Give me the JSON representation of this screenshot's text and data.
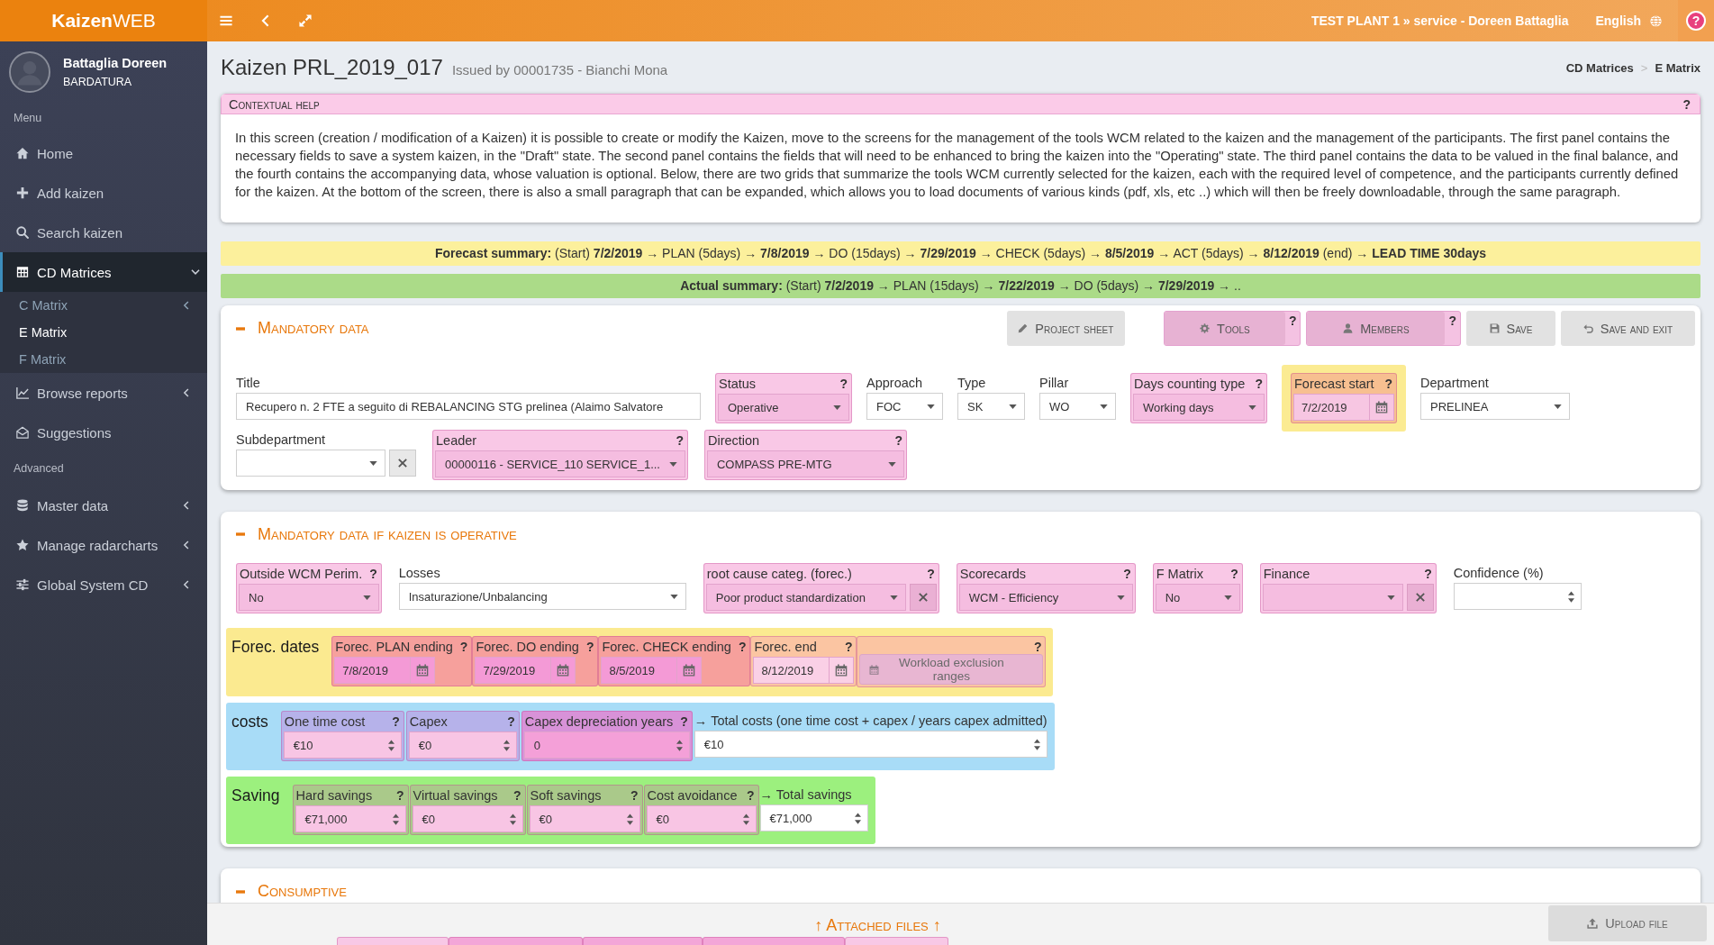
{
  "topbar": {
    "logo": "**Kaizen**WEB",
    "context": "TEST PLANT 1 » service - Doreen Battaglia",
    "language": "English",
    "help": "?"
  },
  "user": {
    "name": "Battaglia Doreen",
    "role": "BARDATURA"
  },
  "sidebar": {
    "sections": [
      {
        "heading": "Menu",
        "items": [
          {
            "label": "Home",
            "kind": "link",
            "selected": false
          },
          {
            "label": "Add kaizen",
            "kind": "link",
            "selected": false
          },
          {
            "label": "Search kaizen",
            "kind": "link",
            "selected": false
          },
          {
            "label": "CD Matrices",
            "kind": "group",
            "selected": true,
            "expanded": true,
            "children": [
              {
                "label": "C Matrix",
                "kind": "group",
                "selected": false,
                "expanded": false
              },
              {
                "label": "E Matrix",
                "kind": "link",
                "selected": true
              },
              {
                "label": "F Matrix",
                "kind": "link",
                "selected": false
              }
            ]
          },
          {
            "label": "Browse reports",
            "kind": "group",
            "selected": false,
            "expanded": false
          },
          {
            "label": "Suggestions",
            "kind": "link",
            "selected": false
          }
        ]
      },
      {
        "heading": "Advanced",
        "items": [
          {
            "label": "Master data",
            "kind": "group",
            "selected": false,
            "expanded": false
          },
          {
            "label": "Manage radarcharts",
            "kind": "group",
            "selected": false,
            "expanded": false
          },
          {
            "label": "Global System CD",
            "kind": "group",
            "selected": false,
            "expanded": false
          }
        ]
      }
    ]
  },
  "page": {
    "title": "Kaizen PRL_2019_017",
    "subtitle": "Issued by 00001735 - Bianchi Mona",
    "breadcrumb": [
      "CD Matrices",
      "E Matrix"
    ],
    "separator": ">"
  },
  "help_panel": {
    "title": "Contextual help",
    "help": "?",
    "text": "In this screen (creation / modification of a Kaizen) it is possible to create or modify the Kaizen, move to the screens for the management of the tools WCM related to the kaizen and the management of the participants. The first panel contains the necessary fields to save a system kaizen, in the \"Draft\" state. The second panel contains the fields that will need to be enhanced to bring the kaizen into the \"Operating\" state. The third panel contains the data to be valued in the final balance, and the fourth contains the accompanying data, whose valuation is optional. Below, there are two grids that summarize the tools WCM currently selected for the kaizen, each with the required level of competence, and the participants currently defined for the kaizen. At the bottom of the screen, there is also a small paragraph that can be expanded, which allows you to load documents of various kinds (pdf, xls, etc ..) which will then be freely downloadable, through the same paragraph."
  },
  "forecast_summary": "**Forecast summary:** (Start) **7/2/2019** → PLAN (5days) → **7/8/2019** → DO (15days) → **7/29/2019** → CHECK (5days) → **8/5/2019** → ACT (5days) → **8/12/2019** (end) → **LEAD TIME 30days**",
  "actual_summary": "**Actual summary:** (Start) **7/2/2019** → PLAN (15days) → **7/22/2019** → DO (5days) → **7/29/2019** → ..",
  "mandatory_panel": {
    "title": "Mandatory data",
    "buttons": [
      {
        "label": "Project sheet"
      },
      {
        "label": "Tools",
        "help": "?",
        "color": "#f4c2e2"
      },
      {
        "label": "Members",
        "help": "?",
        "color": "#f4c2e2"
      },
      {
        "label": "Save"
      },
      {
        "label": "Save and exit"
      }
    ],
    "rows": [
      {
        "fields": [
          {
            "label": "Title",
            "kind": "text",
            "value": "Recupero n. 2 FTE a seguito di REBALANCING STG prelinea (Alaimo Salvatore"
          },
          {
            "label": "Status",
            "kind": "select",
            "value": "Operative",
            "help": "?",
            "color": "#f9c8e6",
            "input": {
              "color": "#f5bde0"
            }
          },
          {
            "label": "Approach",
            "kind": "select",
            "value": "FOC"
          },
          {
            "label": "Type",
            "kind": "select",
            "value": "SK"
          },
          {
            "label": "Pillar",
            "kind": "select",
            "value": "WO"
          },
          {
            "label": "Days counting type",
            "kind": "select",
            "value": "Working days",
            "help": "?",
            "color": "#f9c8e6",
            "input": {
              "color": "#f5bde0"
            }
          },
          {
            "label": "Forecast start",
            "kind": "date",
            "value": "7/2/2019",
            "help": "?",
            "color": "#f7bf90",
            "input": {
              "color": "#f7c6e2"
            },
            "backing": {
              "color": "#fbeb92"
            }
          },
          {
            "label": "Department",
            "kind": "select",
            "value": "PRELINEA"
          }
        ]
      },
      {
        "fields": [
          {
            "label": "Subdepartment",
            "kind": "select-clear"
          },
          {
            "label": "Leader",
            "kind": "select",
            "value": "00000116 - SERVICE_110 SERVICE_1...",
            "help": "?",
            "color": "#f9c8e6",
            "input": {
              "color": "#f5bde0"
            }
          },
          {
            "label": "Direction",
            "kind": "select",
            "value": "COMPASS PRE-MTG",
            "help": "?",
            "color": "#f9c8e6",
            "input": {
              "color": "#f5bde0"
            }
          }
        ]
      }
    ]
  },
  "operative_panel": {
    "title": "Mandatory data if kaizen is operative",
    "fields": [
      {
        "label": "Outside WCM Perim.",
        "kind": "select",
        "value": "No",
        "help": "?",
        "color": "#f9c8e6",
        "input": {
          "color": "#f5bde0"
        }
      },
      {
        "label": "Losses",
        "kind": "select",
        "value": "Insaturazione/Unbalancing"
      },
      {
        "label": "root cause categ. (forec.)",
        "kind": "select-clear",
        "value": "Poor product standardization",
        "help": "?",
        "color": "#f9c8e6",
        "input": {
          "color": "#f5bde0"
        }
      },
      {
        "label": "Scorecards",
        "kind": "select",
        "value": "WCM - Efficiency",
        "help": "?",
        "color": "#f9c8e6",
        "input": {
          "color": "#f5bde0"
        }
      },
      {
        "label": "F Matrix",
        "kind": "select",
        "value": "No",
        "help": "?",
        "color": "#f9c8e6",
        "input": {
          "color": "#f5bde0"
        }
      },
      {
        "label": "Finance",
        "kind": "select-clear",
        "help": "?",
        "color": "#f9c8e6",
        "input": {
          "color": "#f5bde0"
        }
      },
      {
        "label": "Confidence (%)",
        "kind": "number"
      }
    ],
    "groups": [
      {
        "title": "Forec. dates",
        "color": "#fbea90",
        "fields": [
          {
            "label": "Forec. PLAN ending",
            "kind": "date",
            "value": "7/8/2019",
            "help": "?",
            "color": "#f6a09c",
            "input": {
              "color": "#f49ad6"
            }
          },
          {
            "label": "Forec. DO ending",
            "kind": "date",
            "value": "7/29/2019",
            "help": "?",
            "color": "#f6a09c",
            "input": {
              "color": "#f49ad6"
            }
          },
          {
            "label": "Forec. CHECK ending",
            "kind": "date",
            "value": "8/5/2019",
            "help": "?",
            "color": "#f6a09c",
            "input": {
              "color": "#f49ad6"
            }
          },
          {
            "label": "Forec. end",
            "kind": "date",
            "value": "8/12/2019",
            "help": "?",
            "color": "#fbc5a2",
            "input": {
              "color": "#fad0e6"
            }
          },
          {
            "kind": "button",
            "button": "Workload exclusion ranges",
            "help": "?",
            "color": "#fbc5a2",
            "input": {
              "color": "#e8b6d2"
            }
          }
        ]
      },
      {
        "title": "costs",
        "color": "#a8dcf7",
        "fields": [
          {
            "label": "One time cost",
            "kind": "number",
            "value": "€10",
            "help": "?",
            "color": "#b6b2ea",
            "input": {
              "color": "#f8c5e4"
            }
          },
          {
            "label": "Capex",
            "kind": "number",
            "value": "€0",
            "help": "?",
            "color": "#b6b2ea",
            "input": {
              "color": "#f8c5e4"
            }
          },
          {
            "label": "Capex depreciation years",
            "kind": "number",
            "value": "0",
            "help": "?",
            "color": "#d892d8",
            "input": {
              "color": "#f4a0d8"
            }
          },
          {
            "label": "→ Total costs (one time cost + capex / years capex admitted)",
            "kind": "number",
            "value": "€10"
          }
        ]
      },
      {
        "title": "Saving",
        "color": "#9cf07e",
        "fields": [
          {
            "label": "Hard savings",
            "kind": "number",
            "value": "€71,000",
            "help": "?",
            "color": "#aac98a",
            "input": {
              "color": "#f8c5e4"
            }
          },
          {
            "label": "Virtual savings",
            "kind": "number",
            "value": "€0",
            "help": "?",
            "color": "#aac98a",
            "input": {
              "color": "#f8c5e4"
            }
          },
          {
            "label": "Soft savings",
            "kind": "number",
            "value": "€0",
            "help": "?",
            "color": "#aac98a",
            "input": {
              "color": "#f8c5e4"
            }
          },
          {
            "label": "Cost avoidance",
            "kind": "number",
            "value": "€0",
            "help": "?",
            "color": "#aac98a",
            "input": {
              "color": "#f8c5e4"
            }
          },
          {
            "label": "→ Total savings",
            "kind": "number",
            "value": "€71,000"
          }
        ]
      }
    ]
  },
  "consumptive_panel": {
    "title": "Consumptive"
  },
  "attachments": {
    "title": "↑ Attached files ↑",
    "upload": "Upload file",
    "fields": [
      {
        "color": "#f8c8e6"
      },
      {
        "color": "#f3a6d8"
      },
      {
        "color": "#f3a6d8"
      },
      {
        "color": "#f3a6d8"
      },
      {
        "color": "#f8c8e6"
      }
    ]
  }
}
